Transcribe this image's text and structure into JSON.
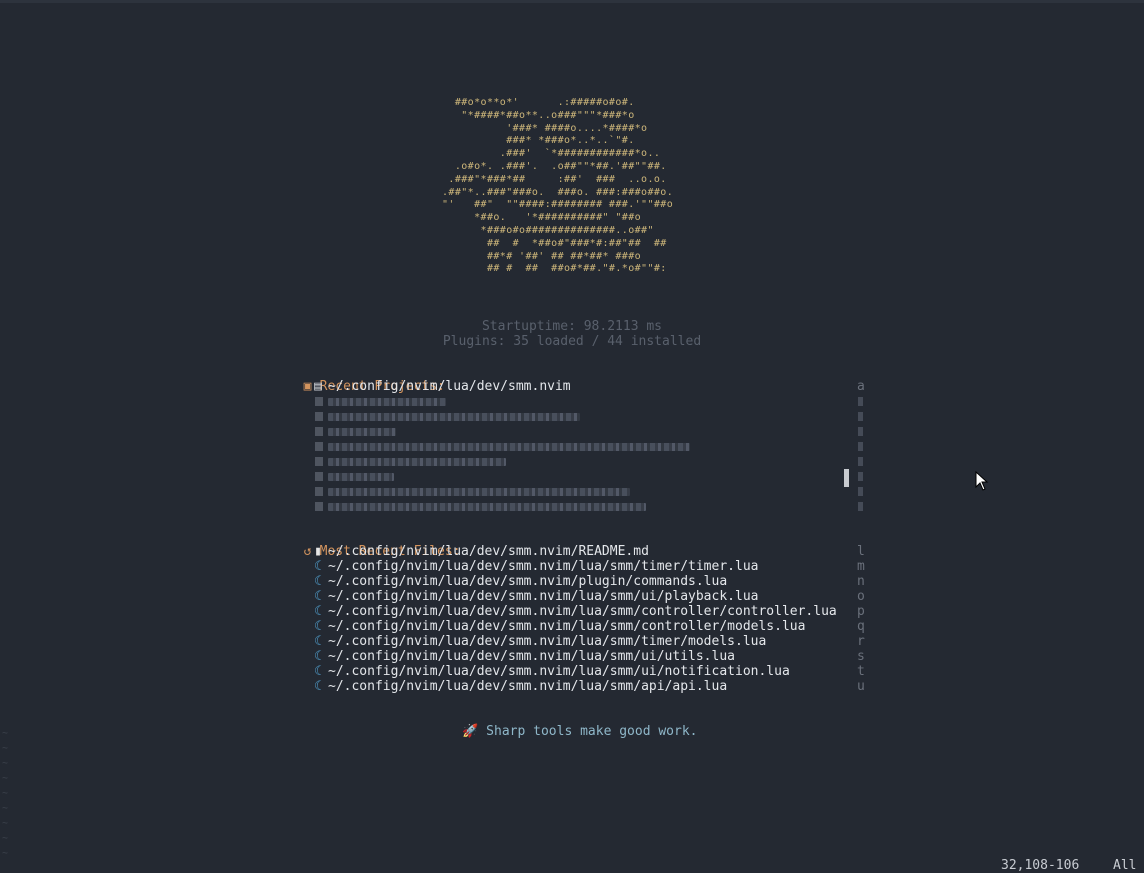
{
  "header": {
    "logo_art": "  ##o*o**o*'      .:#####o#o#.\n   \"*####*##o**..o###\"\"\"*###*o\n          '###* ####o....*####*o\n          ###* *###o*..*..`\"#.\n         .###'  `*############*o..\n  .o#o*. .###'.  .o##\"\"*##.'##\"\"##.\n .###\"*###*##     :##'  ###  ..o.o.\n.##\"*..###\"###o.  ###o. ###:###o##o.\n\"'   ##\"  \"\"####:######## ###.'\"\"##o\n     *##o.   '*##########\" \"##o\n      *###o#o##############..o##\"\n       ##  #  *##o#\"###*#:##\"##  ##\n       ##*# '##' ## ##*##* ###o\n       ## #  ##  ##o#*##.\"#.*o#\"\"#:",
    "startuptime": "Startuptime: 98.2113 ms",
    "plugins": "Plugins: 35 loaded / 44 installed"
  },
  "recent_projects": {
    "title": "Recent Projects:",
    "icon": "book-icon",
    "first_path": "~/.config/nvim/lua/dev/smm.nvim",
    "first_key": "a",
    "blurred_rows": 8
  },
  "recent_files": {
    "title": "Most Recent Files:",
    "icon": "history-icon",
    "items": [
      {
        "path": "~/.config/nvim/lua/dev/smm.nvim/README.md",
        "key": "l",
        "icon": "markdown-file-icon"
      },
      {
        "path": "~/.config/nvim/lua/dev/smm.nvim/lua/smm/timer/timer.lua",
        "key": "m",
        "icon": "lua-file-icon"
      },
      {
        "path": "~/.config/nvim/lua/dev/smm.nvim/plugin/commands.lua",
        "key": "n",
        "icon": "lua-file-icon"
      },
      {
        "path": "~/.config/nvim/lua/dev/smm.nvim/lua/smm/ui/playback.lua",
        "key": "o",
        "icon": "lua-file-icon"
      },
      {
        "path": "~/.config/nvim/lua/dev/smm.nvim/lua/smm/controller/controller.lua",
        "key": "p",
        "icon": "lua-file-icon"
      },
      {
        "path": "~/.config/nvim/lua/dev/smm.nvim/lua/smm/controller/models.lua",
        "key": "q",
        "icon": "lua-file-icon"
      },
      {
        "path": "~/.config/nvim/lua/dev/smm.nvim/lua/smm/timer/models.lua",
        "key": "r",
        "icon": "lua-file-icon"
      },
      {
        "path": "~/.config/nvim/lua/dev/smm.nvim/lua/smm/ui/utils.lua",
        "key": "s",
        "icon": "lua-file-icon"
      },
      {
        "path": "~/.config/nvim/lua/dev/smm.nvim/lua/smm/ui/notification.lua",
        "key": "t",
        "icon": "lua-file-icon"
      },
      {
        "path": "~/.config/nvim/lua/dev/smm.nvim/lua/smm/api/api.lua",
        "key": "u",
        "icon": "lua-file-icon"
      }
    ]
  },
  "footer": {
    "icon": "rocket-icon",
    "quote": "Sharp tools make good work."
  },
  "statusline": {
    "position": "32,108-106",
    "scroll": "All"
  },
  "colors": {
    "background": "#242932",
    "accent": "#d3945e",
    "logo": "#cdb67a",
    "lua": "#51a0cf",
    "footer": "#8fb7c9",
    "muted": "#59606c"
  }
}
